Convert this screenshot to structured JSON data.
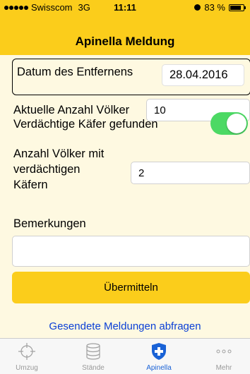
{
  "status": {
    "carrier": "Swisscom",
    "network": "3G",
    "time": "11:11",
    "battery": "83 %",
    "battery_level": 0.83
  },
  "nav": {
    "title": "Apinella Meldung"
  },
  "form": {
    "date_label": "Datum des Entfernens",
    "date_value": "28.04.2016",
    "count_label": "Aktuelle Anzahl Völker",
    "count_value": "10",
    "beetles_label": "Verdächtige Käfer gefunden",
    "beetles_found": true,
    "infected_label_1": "Anzahl Völker mit",
    "infected_label_2": "verdächtigen",
    "infected_label_3": "Käfern",
    "infected_value": "2",
    "remarks_label": "Bemerkungen",
    "remarks_value": "",
    "submit_label": "Übermitteln",
    "query_link": "Gesendete Meldungen abfragen"
  },
  "tabs": [
    {
      "label": "Umzug",
      "icon": "crosshair-icon"
    },
    {
      "label": "Stände",
      "icon": "database-icon"
    },
    {
      "label": "Apinella",
      "icon": "shield-plus-icon"
    },
    {
      "label": "Mehr",
      "icon": "more-icon"
    }
  ],
  "colors": {
    "bar": "#fbcd1b",
    "background": "#fef9e1",
    "toggle": "#4cd964",
    "link": "#0a3fd6",
    "active_tab": "#1a62d6"
  }
}
